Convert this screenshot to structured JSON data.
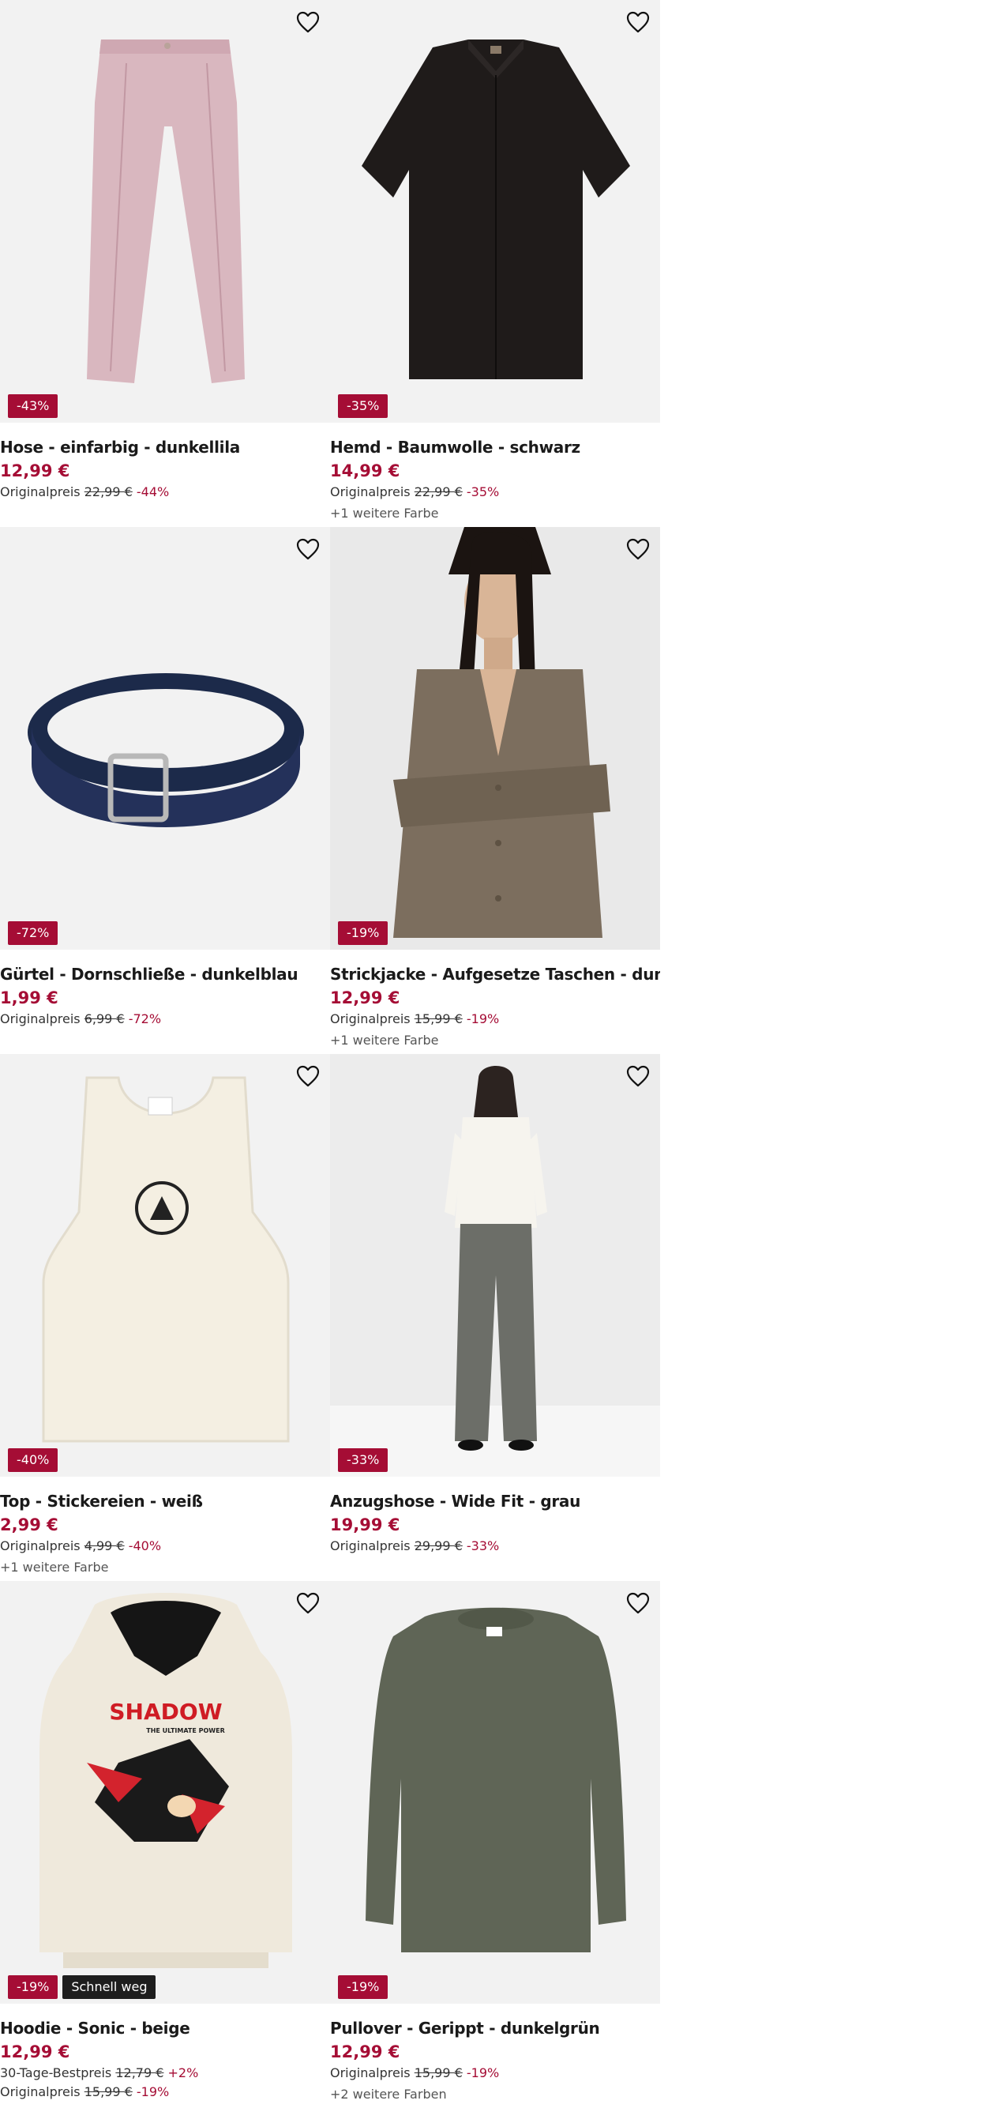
{
  "accent_color": "#a50d35",
  "products": [
    {
      "title": "Hose - einfarbig - dunkellila",
      "badges": [
        "-43%"
      ],
      "price": "12,99 €",
      "ref_label": "Originalpreis",
      "ref_price": "22,99 €",
      "ref_pct": "-44%",
      "colors": "",
      "image": "pink-trousers",
      "icon": "heart-icon"
    },
    {
      "title": "Hemd - Baumwolle - schwarz",
      "badges": [
        "-35%"
      ],
      "price": "14,99 €",
      "ref_label": "Originalpreis",
      "ref_price": "22,99 €",
      "ref_pct": "-35%",
      "colors": "+1 weitere Farbe",
      "image": "black-shirt",
      "icon": "heart-icon"
    },
    {
      "title": "Gürtel - Dornschließe - dunkelblau",
      "badges": [
        "-72%"
      ],
      "price": "1,99 €",
      "ref_label": "Originalpreis",
      "ref_price": "6,99 €",
      "ref_pct": "-72%",
      "colors": "",
      "image": "navy-belt",
      "icon": "heart-icon"
    },
    {
      "title": "Strickjacke - Aufgesetze Taschen - dunkelgrau",
      "badges": [
        "-19%"
      ],
      "price": "12,99 €",
      "ref_label": "Originalpreis",
      "ref_price": "15,99 €",
      "ref_pct": "-19%",
      "colors": "+1 weitere Farbe",
      "image": "model-cardigan",
      "icon": "heart-icon"
    },
    {
      "title": "Top - Stickereien - weiß",
      "badges": [
        "-40%"
      ],
      "price": "2,99 €",
      "ref_label": "Originalpreis",
      "ref_price": "4,99 €",
      "ref_pct": "-40%",
      "colors": "+1 weitere Farbe",
      "image": "white-tank-top",
      "icon": "heart-icon"
    },
    {
      "title": "Anzugshose - Wide Fit - grau",
      "badges": [
        "-33%"
      ],
      "price": "19,99 €",
      "ref_label": "Originalpreis",
      "ref_price": "29,99 €",
      "ref_pct": "-33%",
      "colors": "",
      "image": "model-grey-trousers",
      "icon": "heart-icon"
    },
    {
      "title": "Hoodie - Sonic - beige",
      "badges": [
        "-19%",
        "Schnell weg"
      ],
      "price": "12,99 €",
      "ref_label": "30-Tage-Bestpreis",
      "ref_price": "12,79 €",
      "ref_pct": "+2%",
      "ref2_label": "Originalpreis",
      "ref2_price": "15,99 €",
      "ref2_pct": "-19%",
      "colors": "",
      "image": "beige-hoodie",
      "print_main": "SHADOW",
      "print_sub": "THE ULTIMATE POWER",
      "icon": "heart-icon"
    },
    {
      "title": "Pullover - Gerippt - dunkelgrün",
      "badges": [
        "-19%"
      ],
      "price": "12,99 €",
      "ref_label": "Originalpreis",
      "ref_price": "15,99 €",
      "ref_pct": "-19%",
      "colors": "+2 weitere Farben",
      "image": "green-sweater",
      "icon": "heart-icon"
    }
  ]
}
